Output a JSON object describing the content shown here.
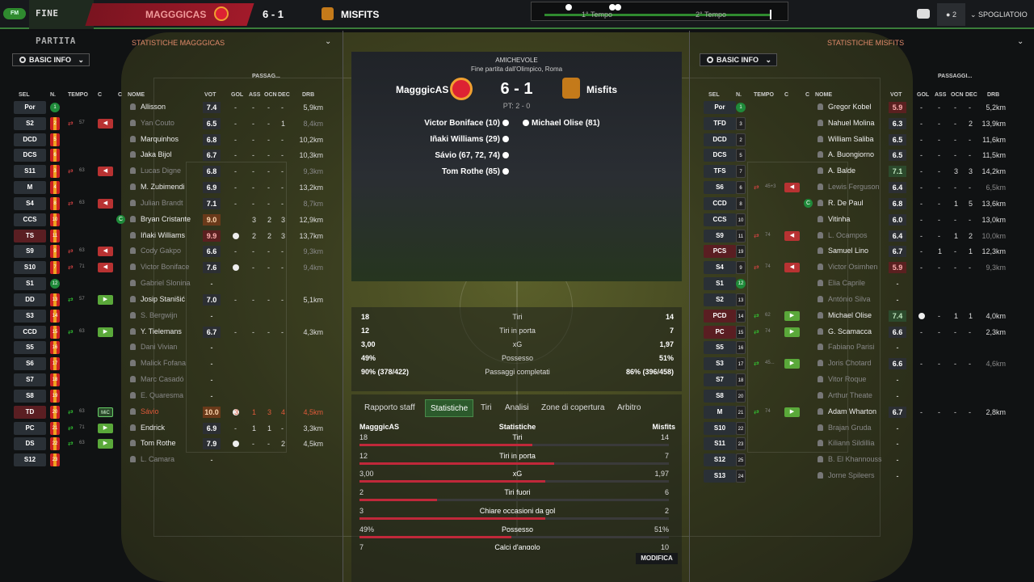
{
  "app": {
    "logo": "FM",
    "status": "FINE PARTITA"
  },
  "top": {
    "home": "MAGGGICAS",
    "score": "6 - 1",
    "away": "MISFITS",
    "first_half": "1° Tempo",
    "second_half": "2° Tempo",
    "count": "2",
    "spogliatoio": "SPOGLIATOIO"
  },
  "colors": {
    "home": "#c0283a",
    "accent": "#2f8a2f"
  },
  "left": {
    "title": "STATISTICHE MAGGGICAS",
    "filter": "BASIC INFO",
    "headers": {
      "sel": "SEL",
      "n": "N.",
      "tempo": "TEMPO",
      "c1": "C",
      "c2": "C",
      "nome": "NOME",
      "vot": "VOT",
      "gol": "GOL",
      "ass": "ASS",
      "ocn": "OCN",
      "dec": "DEC",
      "drb": "DRB",
      "passaggi": "PASSAG..."
    },
    "players": [
      {
        "sel": "Por",
        "n": "1",
        "gk": true,
        "name": "Allisson",
        "vot": "7.4",
        "gol": "-",
        "ass": "-",
        "ocn": "-",
        "dec": "-",
        "drb": "5,9km"
      },
      {
        "sel": "S2",
        "n": "2",
        "sub": "out",
        "min": "57",
        "mark": "red",
        "name": "Yan Couto",
        "dim": true,
        "vot": "6.5",
        "gol": "-",
        "ass": "-",
        "ocn": "-",
        "dec": "1",
        "drb": "8,4km"
      },
      {
        "sel": "DCD",
        "n": "5",
        "name": "Marquinhos",
        "vot": "6.8",
        "gol": "-",
        "ass": "-",
        "ocn": "-",
        "dec": "-",
        "drb": "10,2km"
      },
      {
        "sel": "DCS",
        "n": "6",
        "name": "Jaka Bijol",
        "vot": "6.7",
        "gol": "-",
        "ass": "-",
        "ocn": "-",
        "dec": "-",
        "drb": "10,3km"
      },
      {
        "sel": "S11",
        "n": "3",
        "sub": "out",
        "min": "63",
        "mark": "red",
        "name": "Lucas Digne",
        "dim": true,
        "vot": "6.8",
        "gol": "-",
        "ass": "-",
        "ocn": "-",
        "dec": "-",
        "drb": "9,3km"
      },
      {
        "sel": "M",
        "n": "4",
        "name": "M. Zubimendi",
        "vot": "6.9",
        "gol": "-",
        "ass": "-",
        "ocn": "-",
        "dec": "-",
        "drb": "13,2km"
      },
      {
        "sel": "S4",
        "n": "8",
        "sub": "out",
        "min": "63",
        "mark": "red",
        "name": "Julian Brandt",
        "dim": true,
        "vot": "7.1",
        "gol": "-",
        "ass": "-",
        "ocn": "-",
        "dec": "-",
        "drb": "8,7km"
      },
      {
        "sel": "CCS",
        "n": "10",
        "cap": true,
        "name": "Bryan Cristante",
        "vot": "9.0",
        "vclass": "o",
        "gol": "",
        "ass": "3",
        "ocn": "2",
        "dec": "3",
        "drb": "12,9km"
      },
      {
        "sel": "TS",
        "n": "11",
        "red": true,
        "name": "Iñaki Williams",
        "vot": "9.9",
        "vclass": "r",
        "ball": true,
        "gol": "",
        "ass": "2",
        "ocn": "2",
        "dec": "3",
        "drb": "13,7km"
      },
      {
        "sel": "S9",
        "n": "9",
        "sub": "out",
        "min": "63",
        "mark": "red",
        "name": "Cody Gakpo",
        "dim": true,
        "vot": "6.6",
        "gol": "-",
        "ass": "-",
        "ocn": "-",
        "dec": "-",
        "drb": "9,3km"
      },
      {
        "sel": "S10",
        "n": "7",
        "sub": "out",
        "min": "71",
        "mark": "red",
        "name": "Victor Boniface",
        "dim": true,
        "vot": "7.6",
        "ball": true,
        "gol": "",
        "ass": "-",
        "ocn": "-",
        "dec": "-",
        "drb": "9,4km"
      },
      {
        "sel": "S1",
        "n": "12",
        "gk": true,
        "name": "Gabriel Slonina",
        "dim": true,
        "vot": "-",
        "gol": "",
        "ass": "",
        "ocn": "",
        "dec": "",
        "drb": ""
      },
      {
        "sel": "DD",
        "n": "13",
        "sub": "in",
        "min": "57",
        "mark": "green",
        "name": "Josip Stanišić",
        "vot": "7.0",
        "gol": "-",
        "ass": "-",
        "ocn": "-",
        "dec": "-",
        "drb": "5,1km"
      },
      {
        "sel": "S3",
        "n": "14",
        "name": "S. Bergwijn",
        "dim": true,
        "vot": "-",
        "gol": "",
        "ass": "",
        "ocn": "",
        "dec": "",
        "drb": ""
      },
      {
        "sel": "CCD",
        "n": "15",
        "sub": "in",
        "min": "63",
        "mark": "green",
        "name": "Y. Tielemans",
        "vot": "6.7",
        "gol": "-",
        "ass": "-",
        "ocn": "-",
        "dec": "-",
        "drb": "4,3km"
      },
      {
        "sel": "S5",
        "n": "16",
        "name": "Dani Vivian",
        "dim": true,
        "vot": "-",
        "gol": "",
        "ass": "",
        "ocn": "",
        "dec": "",
        "drb": ""
      },
      {
        "sel": "S6",
        "n": "17",
        "name": "Malick Fofana",
        "dim": true,
        "vot": "-",
        "gol": "",
        "ass": "",
        "ocn": "",
        "dec": "",
        "drb": ""
      },
      {
        "sel": "S7",
        "n": "18",
        "name": "Marc Casadó",
        "dim": true,
        "vot": "-",
        "gol": "",
        "ass": "",
        "ocn": "",
        "dec": "",
        "drb": ""
      },
      {
        "sel": "S8",
        "n": "19",
        "name": "E. Quaresma",
        "dim": true,
        "vot": "-",
        "gol": "",
        "ass": "",
        "ocn": "",
        "dec": "",
        "drb": ""
      },
      {
        "sel": "TD",
        "n": "20",
        "red": true,
        "sub": "in",
        "min": "63",
        "mark": "mic",
        "marklabel": "MiC",
        "name": "Sávio",
        "sent": true,
        "vot": "10.0",
        "vclass": "o",
        "ball": true,
        "gol": "3",
        "ass": "1",
        "ocn": "3",
        "dec": "4",
        "drb": "4,5km"
      },
      {
        "sel": "PC",
        "n": "21",
        "sub": "in",
        "min": "71",
        "mark": "green",
        "name": "Endrick",
        "vot": "6.9",
        "gol": "-",
        "ass": "1",
        "ocn": "1",
        "dec": "-",
        "drb": "3,3km"
      },
      {
        "sel": "DS",
        "n": "22",
        "sub": "in",
        "min": "63",
        "mark": "green",
        "name": "Tom Rothe",
        "vot": "7.9",
        "ball": true,
        "gol": "",
        "ass": "-",
        "ocn": "-",
        "dec": "2",
        "drb": "4,5km"
      },
      {
        "sel": "S12",
        "n": "23",
        "name": "L. Camara",
        "dim": true,
        "vot": "-",
        "gol": "",
        "ass": "",
        "ocn": "",
        "dec": "",
        "drb": ""
      }
    ]
  },
  "right": {
    "title": "STATISTICHE MISFITS",
    "filter": "BASIC INFO",
    "headers": {
      "sel": "SEL",
      "n": "N.",
      "tempo": "TEMPO",
      "c1": "C",
      "c2": "C",
      "nome": "NOME",
      "vot": "VOT",
      "gol": "GOL",
      "ass": "ASS",
      "ocn": "OCN",
      "dec": "DEC",
      "drb": "DRB",
      "passaggi": "PASSAGGI..."
    },
    "players": [
      {
        "sel": "Por",
        "n": "1",
        "gk": true,
        "name": "Gregor Kobel",
        "vot": "5.9",
        "vclass": "r",
        "gol": "-",
        "ass": "-",
        "ocn": "-",
        "dec": "-",
        "drb": "5,2km"
      },
      {
        "sel": "TFD",
        "n": "3",
        "name": "Nahuel Molina",
        "vot": "6.3",
        "gol": "-",
        "ass": "-",
        "ocn": "-",
        "dec": "2",
        "drb": "13,9km"
      },
      {
        "sel": "DCD",
        "n": "2",
        "name": "William Saliba",
        "vot": "6.5",
        "gol": "-",
        "ass": "-",
        "ocn": "-",
        "dec": "-",
        "drb": "11,6km"
      },
      {
        "sel": "DCS",
        "n": "5",
        "name": "A. Buongiorno",
        "vot": "6.5",
        "gol": "-",
        "ass": "-",
        "ocn": "-",
        "dec": "-",
        "drb": "11,5km"
      },
      {
        "sel": "TFS",
        "n": "7",
        "name": "A. Balde",
        "vot": "7.1",
        "vclass": "g",
        "gol": "-",
        "ass": "-",
        "ocn": "3",
        "dec": "3",
        "drb": "14,2km"
      },
      {
        "sel": "S6",
        "n": "6",
        "sub": "out",
        "min": "45+3",
        "mark": "red",
        "name": "Lewis Ferguson",
        "dim": true,
        "vot": "6.4",
        "gol": "-",
        "ass": "-",
        "ocn": "-",
        "dec": "-",
        "drb": "6,5km"
      },
      {
        "sel": "CCD",
        "n": "8",
        "cap": true,
        "name": "R. De Paul",
        "vot": "6.8",
        "gol": "-",
        "ass": "-",
        "ocn": "1",
        "dec": "5",
        "drb": "13,6km"
      },
      {
        "sel": "CCS",
        "n": "10",
        "name": "Vitinha",
        "vot": "6.0",
        "gol": "-",
        "ass": "-",
        "ocn": "-",
        "dec": "-",
        "drb": "13,0km"
      },
      {
        "sel": "S9",
        "n": "11",
        "sub": "out",
        "min": "74",
        "mark": "red",
        "name": "L. Ocampos",
        "dim": true,
        "vot": "6.4",
        "gol": "-",
        "ass": "-",
        "ocn": "1",
        "dec": "2",
        "drb": "10,0km"
      },
      {
        "sel": "PCS",
        "n": "19",
        "red": true,
        "name": "Samuel Lino",
        "vot": "6.7",
        "gol": "-",
        "ass": "1",
        "ocn": "-",
        "dec": "1",
        "drb": "12,3km"
      },
      {
        "sel": "S4",
        "n": "9",
        "sub": "out",
        "min": "74",
        "mark": "red",
        "name": "Victor Osimhen",
        "dim": true,
        "vot": "5.9",
        "vclass": "r",
        "gol": "-",
        "ass": "-",
        "ocn": "-",
        "dec": "-",
        "drb": "9,3km"
      },
      {
        "sel": "S1",
        "n": "12",
        "gk": true,
        "name": "Elia Caprile",
        "dim": true,
        "vot": "-",
        "gol": "",
        "ass": "",
        "ocn": "",
        "dec": "",
        "drb": ""
      },
      {
        "sel": "S2",
        "n": "13",
        "name": "António Silva",
        "dim": true,
        "vot": "-",
        "gol": "",
        "ass": "",
        "ocn": "",
        "dec": "",
        "drb": ""
      },
      {
        "sel": "PCD",
        "n": "14",
        "red": true,
        "sub": "in",
        "min": "62",
        "mark": "green",
        "name": "Michael Olise",
        "vot": "7.4",
        "vclass": "g",
        "ball": true,
        "gol": "",
        "ass": "-",
        "ocn": "1",
        "dec": "1",
        "drb": "4,0km"
      },
      {
        "sel": "PC",
        "n": "15",
        "red": true,
        "sub": "in",
        "min": "74",
        "mark": "green",
        "name": "G. Scamacca",
        "vot": "6.6",
        "gol": "-",
        "ass": "-",
        "ocn": "-",
        "dec": "-",
        "drb": "2,3km"
      },
      {
        "sel": "S5",
        "n": "16",
        "name": "Fabiano Parisi",
        "dim": true,
        "vot": "-",
        "gol": "",
        "ass": "",
        "ocn": "",
        "dec": "",
        "drb": ""
      },
      {
        "sel": "S3",
        "n": "17",
        "sub": "in",
        "min": "45...",
        "mark": "green",
        "name": "Joris Chotard",
        "dim": true,
        "vot": "6.6",
        "gol": "-",
        "ass": "-",
        "ocn": "-",
        "dec": "-",
        "drb": "4,6km"
      },
      {
        "sel": "S7",
        "n": "18",
        "name": "Vitor Roque",
        "dim": true,
        "vot": "-",
        "gol": "",
        "ass": "",
        "ocn": "",
        "dec": "",
        "drb": ""
      },
      {
        "sel": "S8",
        "n": "20",
        "name": "Arthur Theate",
        "dim": true,
        "vot": "-",
        "gol": "",
        "ass": "",
        "ocn": "",
        "dec": "",
        "drb": ""
      },
      {
        "sel": "M",
        "n": "21",
        "sub": "in",
        "min": "74",
        "mark": "green",
        "name": "Adam Wharton",
        "vot": "6.7",
        "gol": "-",
        "ass": "-",
        "ocn": "-",
        "dec": "-",
        "drb": "2,8km"
      },
      {
        "sel": "S10",
        "n": "22",
        "name": "Brajan Gruda",
        "dim": true,
        "vot": "-",
        "gol": "",
        "ass": "",
        "ocn": "",
        "dec": "",
        "drb": ""
      },
      {
        "sel": "S11",
        "n": "23",
        "name": "Kiliann Sildillia",
        "dim": true,
        "vot": "-",
        "gol": "",
        "ass": "",
        "ocn": "",
        "dec": "",
        "drb": ""
      },
      {
        "sel": "S12",
        "n": "25",
        "name": "B. El Khannouss",
        "dim": true,
        "vot": "-",
        "gol": "",
        "ass": "",
        "ocn": "",
        "dec": "",
        "drb": ""
      },
      {
        "sel": "S13",
        "n": "24",
        "name": "Jorne Spileers",
        "dim": true,
        "vot": "-",
        "gol": "",
        "ass": "",
        "ocn": "",
        "dec": "",
        "drb": ""
      }
    ]
  },
  "match": {
    "competition": "AMICHEVOLE",
    "venue": "Fine partita dall'Olimpico, Roma",
    "home": "MagggicAS",
    "away": "Misfits",
    "score": "6 - 1",
    "ht": "PT: 2 - 0",
    "home_scorers": [
      "Victor Boniface (10)",
      "Iñaki Williams (29)",
      "Sávio (67, 72, 74)",
      "Tom Rothe (85)"
    ],
    "away_scorers": [
      "Michael Olise (81)"
    ]
  },
  "summary": [
    {
      "l": "18",
      "m": "Tiri",
      "r": "14"
    },
    {
      "l": "12",
      "m": "Tiri in porta",
      "r": "7"
    },
    {
      "l": "3,00",
      "m": "xG",
      "r": "1,97"
    },
    {
      "l": "49%",
      "m": "Possesso",
      "r": "51%"
    },
    {
      "l": "90% (378/422)",
      "m": "Passaggi completati",
      "r": "86% (396/458)"
    }
  ],
  "tabs": [
    "Rapporto staff",
    "Statistiche",
    "Tiri",
    "Analisi",
    "Zone di copertura",
    "Arbitro"
  ],
  "stats": {
    "home": "MagggicAS",
    "title": "Statistiche",
    "away": "Misfits",
    "rows": [
      {
        "l": "18",
        "m": "Tiri",
        "r": "14",
        "f": 0.56
      },
      {
        "l": "12",
        "m": "Tiri in porta",
        "r": "7",
        "f": 0.63
      },
      {
        "l": "3,00",
        "m": "xG",
        "r": "1,97",
        "f": 0.6
      },
      {
        "l": "2",
        "m": "Tiri fuori",
        "r": "6",
        "f": 0.25
      },
      {
        "l": "3",
        "m": "Chiare occasioni da gol",
        "r": "2",
        "f": 0.6
      },
      {
        "l": "49%",
        "m": "Possesso",
        "r": "51%",
        "f": 0.49
      },
      {
        "l": "7",
        "m": "Calci d'angolo",
        "r": "10",
        "f": 0.41
      }
    ]
  },
  "modifica": "MODIFICA"
}
